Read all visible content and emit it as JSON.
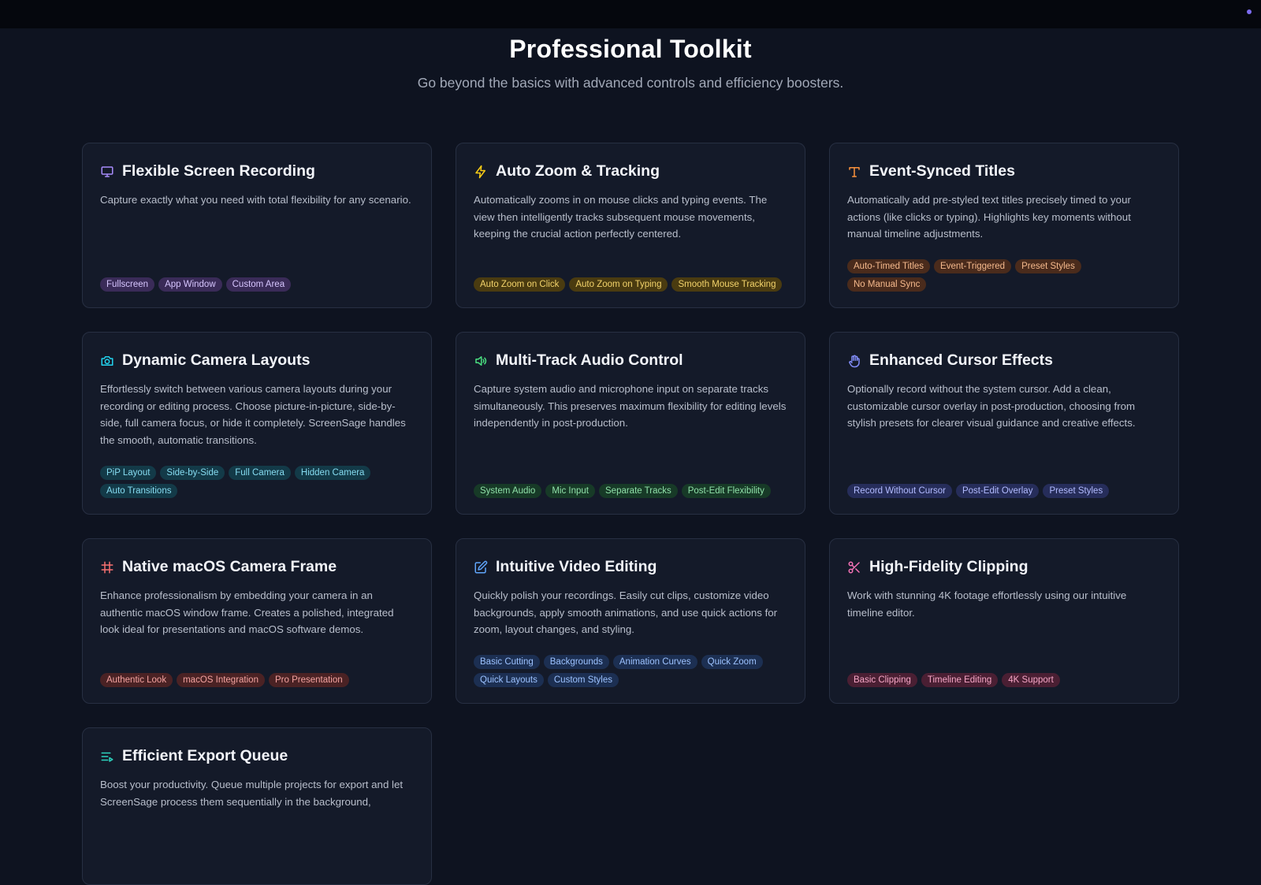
{
  "header": {
    "title": "Professional Toolkit",
    "subtitle": "Go beyond the basics with advanced controls and efficiency boosters."
  },
  "colors": {
    "background": "#0e1320",
    "card": "#141a29",
    "purple": "#a78bfa",
    "yellow": "#facc15",
    "orange": "#fb923c",
    "cyan": "#22d3ee",
    "green": "#4ade80",
    "indigo": "#818cf8",
    "red": "#f87171",
    "blue": "#60a5fa",
    "pink": "#f472b6",
    "teal": "#2dd4bf"
  },
  "cards": [
    {
      "icon": "monitor-icon",
      "title": "Flexible Screen Recording",
      "description": "Capture exactly what you need with total flexibility for any scenario.",
      "tags": [
        "Fullscreen",
        "App Window",
        "Custom Area"
      ]
    },
    {
      "icon": "lightning-icon",
      "title": "Auto Zoom & Tracking",
      "description": "Automatically zooms in on mouse clicks and typing events. The view then intelligently tracks subsequent mouse movements, keeping the crucial action perfectly centered.",
      "tags": [
        "Auto Zoom on Click",
        "Auto Zoom on Typing",
        "Smooth Mouse Tracking"
      ]
    },
    {
      "icon": "text-icon",
      "title": "Event-Synced Titles",
      "description": "Automatically add pre-styled text titles precisely timed to your actions (like clicks or typing). Highlights key moments without manual timeline adjustments.",
      "tags": [
        "Auto-Timed Titles",
        "Event-Triggered",
        "Preset Styles",
        "No Manual Sync"
      ]
    },
    {
      "icon": "camera-icon",
      "title": "Dynamic Camera Layouts",
      "description": "Effortlessly switch between various camera layouts during your recording or editing process. Choose picture-in-picture, side-by-side, full camera focus, or hide it completely. ScreenSage handles the smooth, automatic transitions.",
      "tags": [
        "PiP Layout",
        "Side-by-Side",
        "Full Camera",
        "Hidden Camera",
        "Auto Transitions"
      ]
    },
    {
      "icon": "speaker-icon",
      "title": "Multi-Track Audio Control",
      "description": "Capture system audio and microphone input on separate tracks simultaneously. This preserves maximum flexibility for editing levels independently in post-production.",
      "tags": [
        "System Audio",
        "Mic Input",
        "Separate Tracks",
        "Post-Edit Flexibility"
      ]
    },
    {
      "icon": "hand-pointer-icon",
      "title": "Enhanced Cursor Effects",
      "description": "Optionally record without the system cursor. Add a clean, customizable cursor overlay in post-production, choosing from stylish presets for clearer visual guidance and creative effects.",
      "tags": [
        "Record Without Cursor",
        "Post-Edit Overlay",
        "Preset Styles"
      ]
    },
    {
      "icon": "frame-icon",
      "title": "Native macOS Camera Frame",
      "description": "Enhance professionalism by embedding your camera in an authentic macOS window frame. Creates a polished, integrated look ideal for presentations and macOS software demos.",
      "tags": [
        "Authentic Look",
        "macOS Integration",
        "Pro Presentation"
      ]
    },
    {
      "icon": "edit-icon",
      "title": "Intuitive Video Editing",
      "description": "Quickly polish your recordings. Easily cut clips, customize video backgrounds, apply smooth animations, and use quick actions for zoom, layout changes, and styling.",
      "tags": [
        "Basic Cutting",
        "Backgrounds",
        "Animation Curves",
        "Quick Zoom",
        "Quick Layouts",
        "Custom Styles"
      ]
    },
    {
      "icon": "scissors-icon",
      "title": "High-Fidelity Clipping",
      "description": "Work with stunning 4K footage effortlessly using our intuitive timeline editor.",
      "tags": [
        "Basic Clipping",
        "Timeline Editing",
        "4K Support"
      ]
    },
    {
      "icon": "list-queue-icon",
      "title": "Efficient Export Queue",
      "description": "Boost your productivity. Queue multiple projects for export and let ScreenSage process them sequentially in the background,",
      "tags": []
    }
  ]
}
